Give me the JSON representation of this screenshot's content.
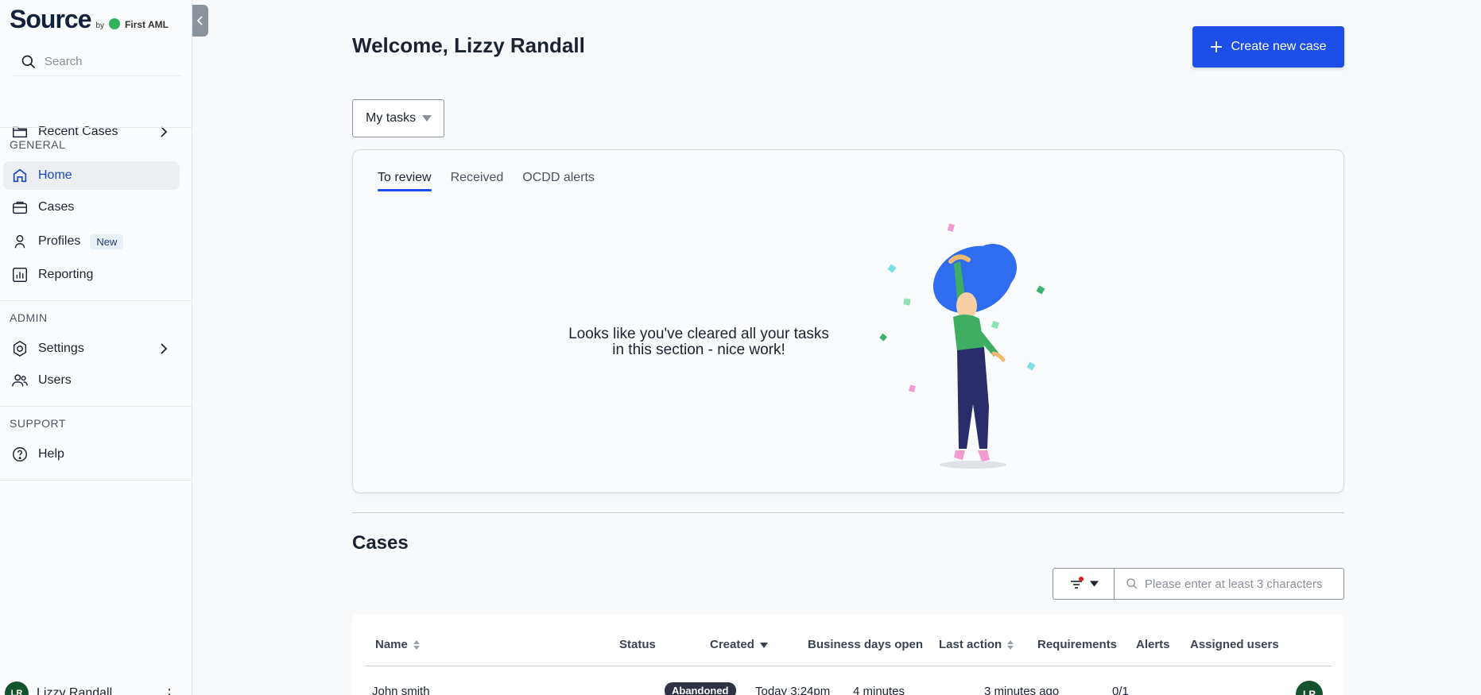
{
  "brand": {
    "name": "Source",
    "by": "by",
    "partner": "First AML"
  },
  "search": {
    "placeholder": "Search"
  },
  "recent_cases": {
    "label": "Recent Cases"
  },
  "sections": {
    "general": "GENERAL",
    "admin": "ADMIN",
    "support": "SUPPORT"
  },
  "nav": {
    "home": "Home",
    "cases": "Cases",
    "profiles": "Profiles",
    "profiles_badge": "New",
    "reporting": "Reporting",
    "settings": "Settings",
    "users": "Users",
    "help": "Help"
  },
  "user": {
    "initials": "LR",
    "name": "Lizzy Randall"
  },
  "main": {
    "welcome": "Welcome, Lizzy Randall",
    "create_button": "Create new case",
    "task_filter": "My tasks"
  },
  "tasks": {
    "tabs": [
      "To review",
      "Received",
      "OCDD alerts"
    ],
    "active_tab": "To review",
    "empty_message": "Looks like you've cleared all your tasks in this section - nice work!"
  },
  "cases": {
    "title": "Cases",
    "search_placeholder": "Please enter at least 3 characters",
    "columns": [
      "Name",
      "Status",
      "Created",
      "Business days open",
      "Last action",
      "Requirements",
      "Alerts",
      "Assigned users"
    ],
    "rows": [
      {
        "name": "John smith",
        "status": "Abandoned",
        "created": "Today 3:24pm",
        "business_days_open": "4 minutes",
        "last_action": "3 minutes ago",
        "requirements": "0/1",
        "alerts": "",
        "assigned_initials": "LR"
      }
    ]
  },
  "colors": {
    "accent": "#1d4ee8",
    "active_nav_text": "#1b44c8",
    "avatar": "#14532d",
    "status_abandoned": "#2d3340"
  }
}
